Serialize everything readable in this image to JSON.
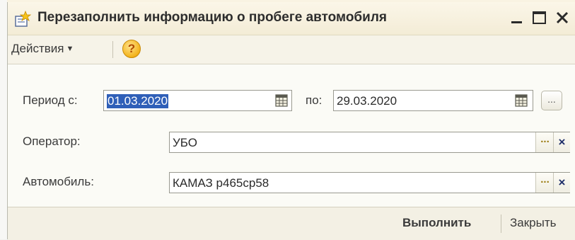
{
  "window": {
    "title": "Перезаполнить информацию о пробеге автомобиля"
  },
  "toolbar": {
    "actions_label": "Действия",
    "help_label": "?"
  },
  "form": {
    "period_from_label": "Период с:",
    "period_from_value": "01.03.2020",
    "period_to_label": "по:",
    "period_to_value": "29.03.2020",
    "period_select_label": "...",
    "operator_label": "Оператор:",
    "operator_value": "УБО",
    "vehicle_label": "Автомобиль:",
    "vehicle_value": "КАМАЗ р465ср58",
    "pick_label": "...",
    "clear_label": "×"
  },
  "footer": {
    "run_label": "Выполнить",
    "close_label": "Закрыть"
  },
  "colors": {
    "selection": "#2f5fb8",
    "clear_x": "#1f2f6a",
    "pick_dots": "#9a7a10"
  }
}
